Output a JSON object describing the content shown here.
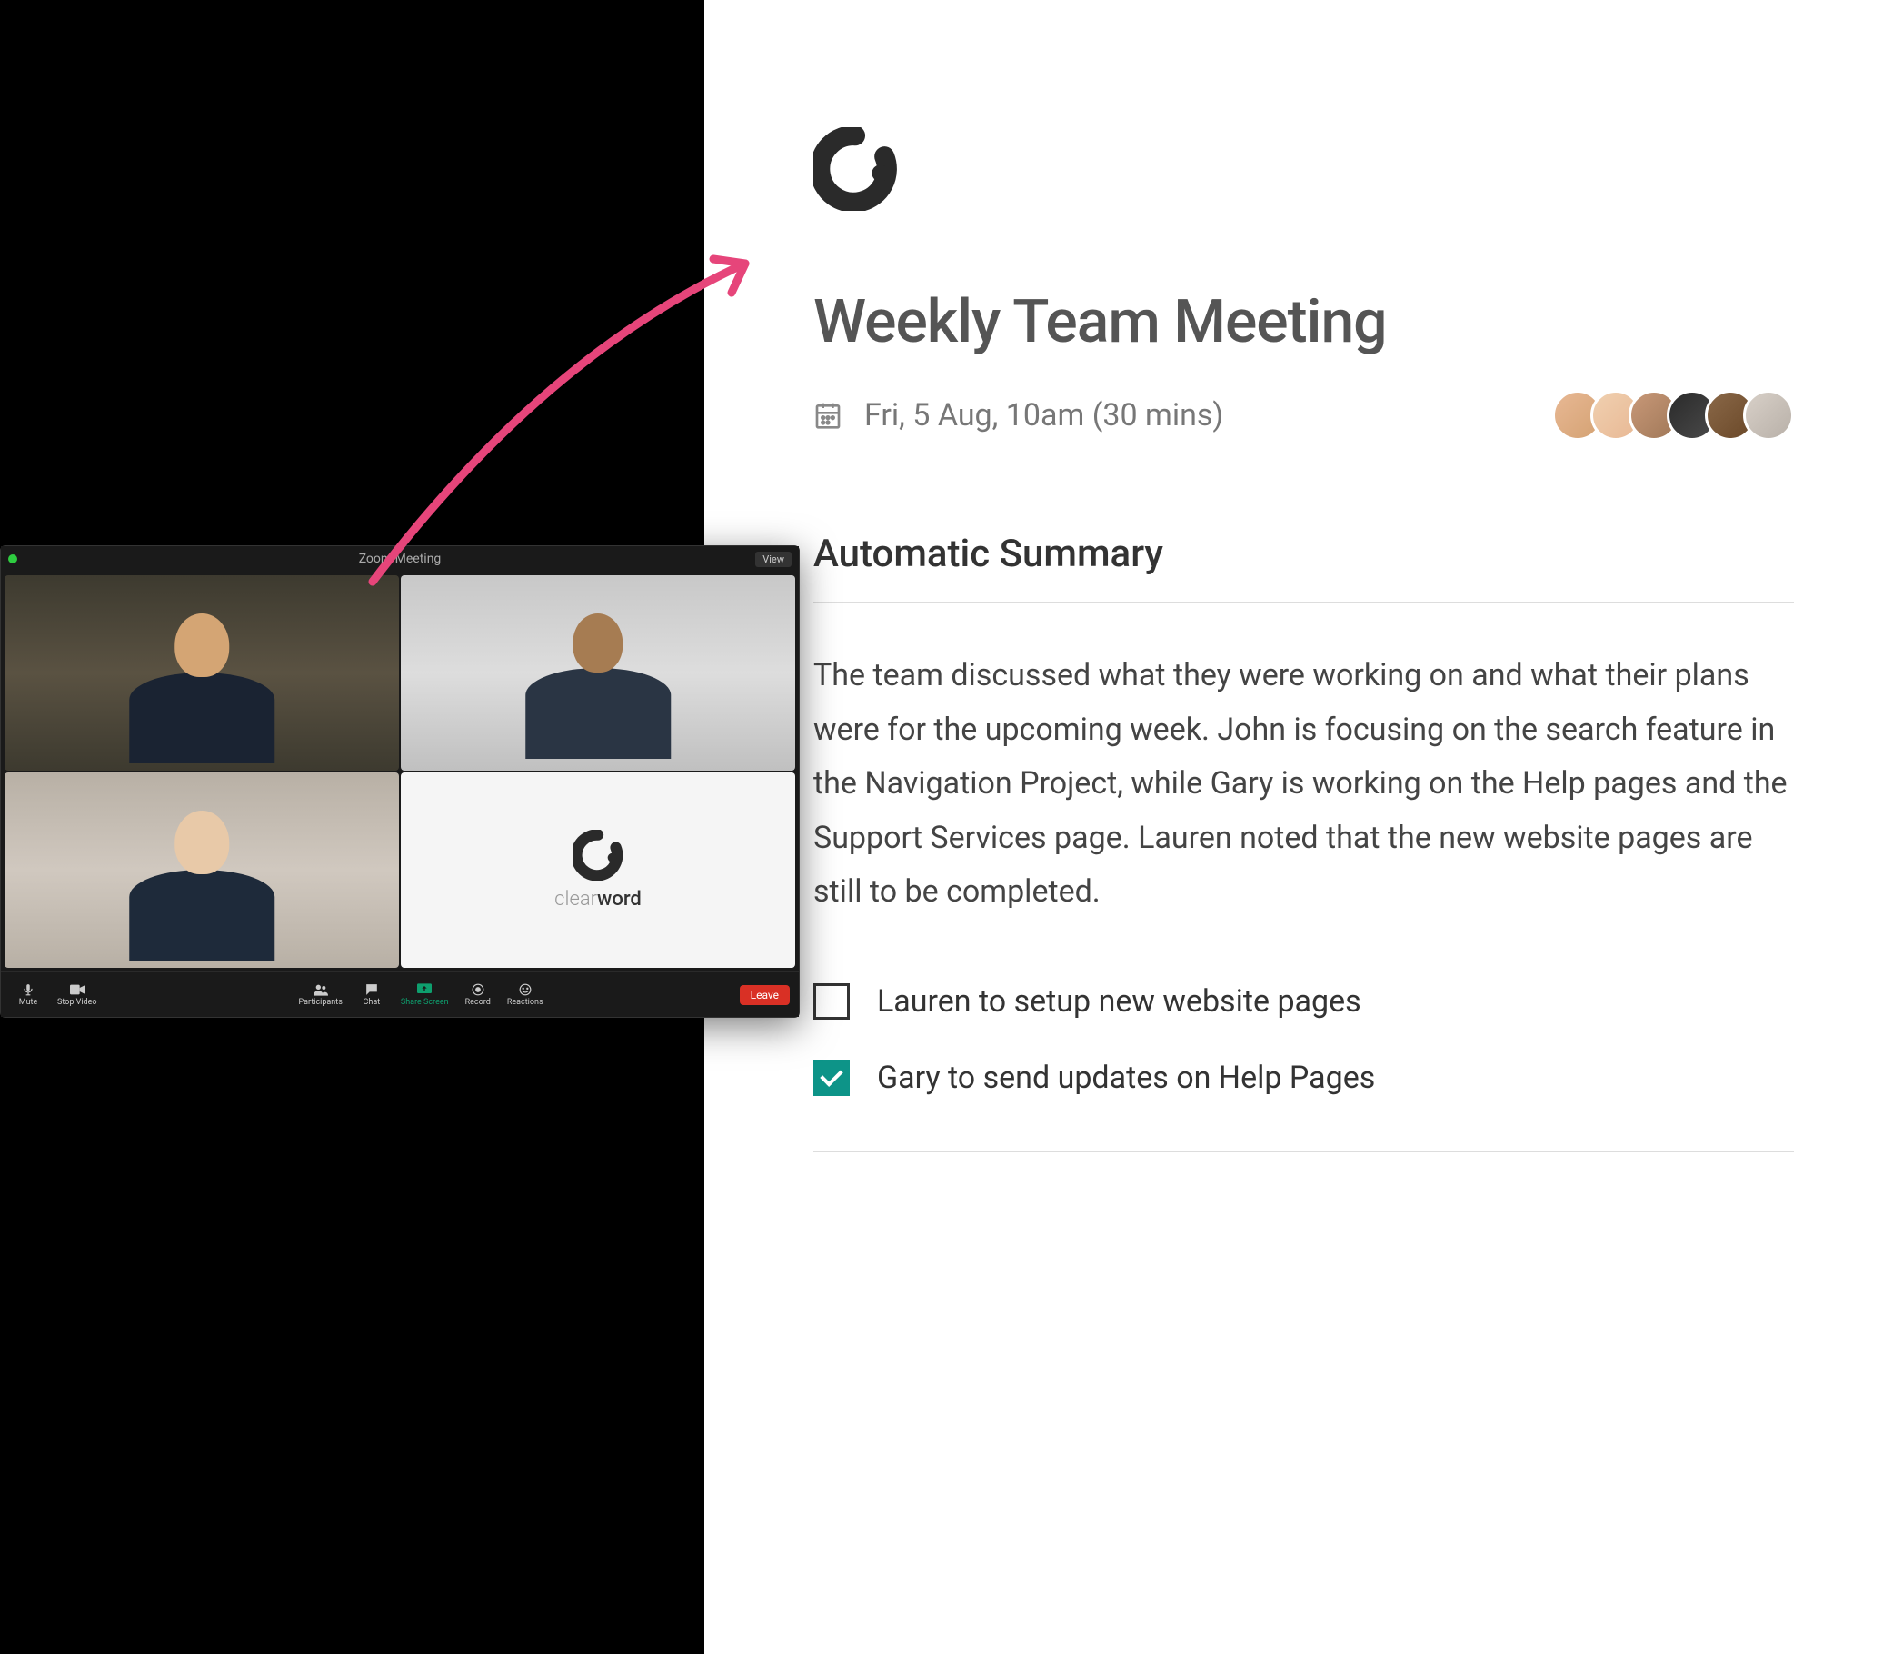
{
  "zoom": {
    "title": "Zoom Meeting",
    "view_button": "View",
    "tile_brand_light": "clear",
    "tile_brand_bold": "word",
    "toolbar": {
      "mute": "Mute",
      "stop_video": "Stop Video",
      "participants": "Participants",
      "chat": "Chat",
      "share_screen": "Share Screen",
      "record": "Record",
      "reactions": "Reactions",
      "leave": "Leave"
    }
  },
  "report": {
    "title": "Weekly Team Meeting",
    "date": "Fri, 5 Aug, 10am (30 mins)",
    "section_title": "Automatic Summary",
    "summary": "The team discussed what they were working on and what their plans were for the upcoming week. John is focusing on the search feature in the Navigation Project, while Gary is working on the Help pages and the Support Services page. Lauren noted that the new website pages are still to be completed.",
    "tasks": [
      {
        "label": "Lauren to setup new website pages",
        "done": false
      },
      {
        "label": "Gary to send updates on Help Pages",
        "done": true
      }
    ]
  }
}
